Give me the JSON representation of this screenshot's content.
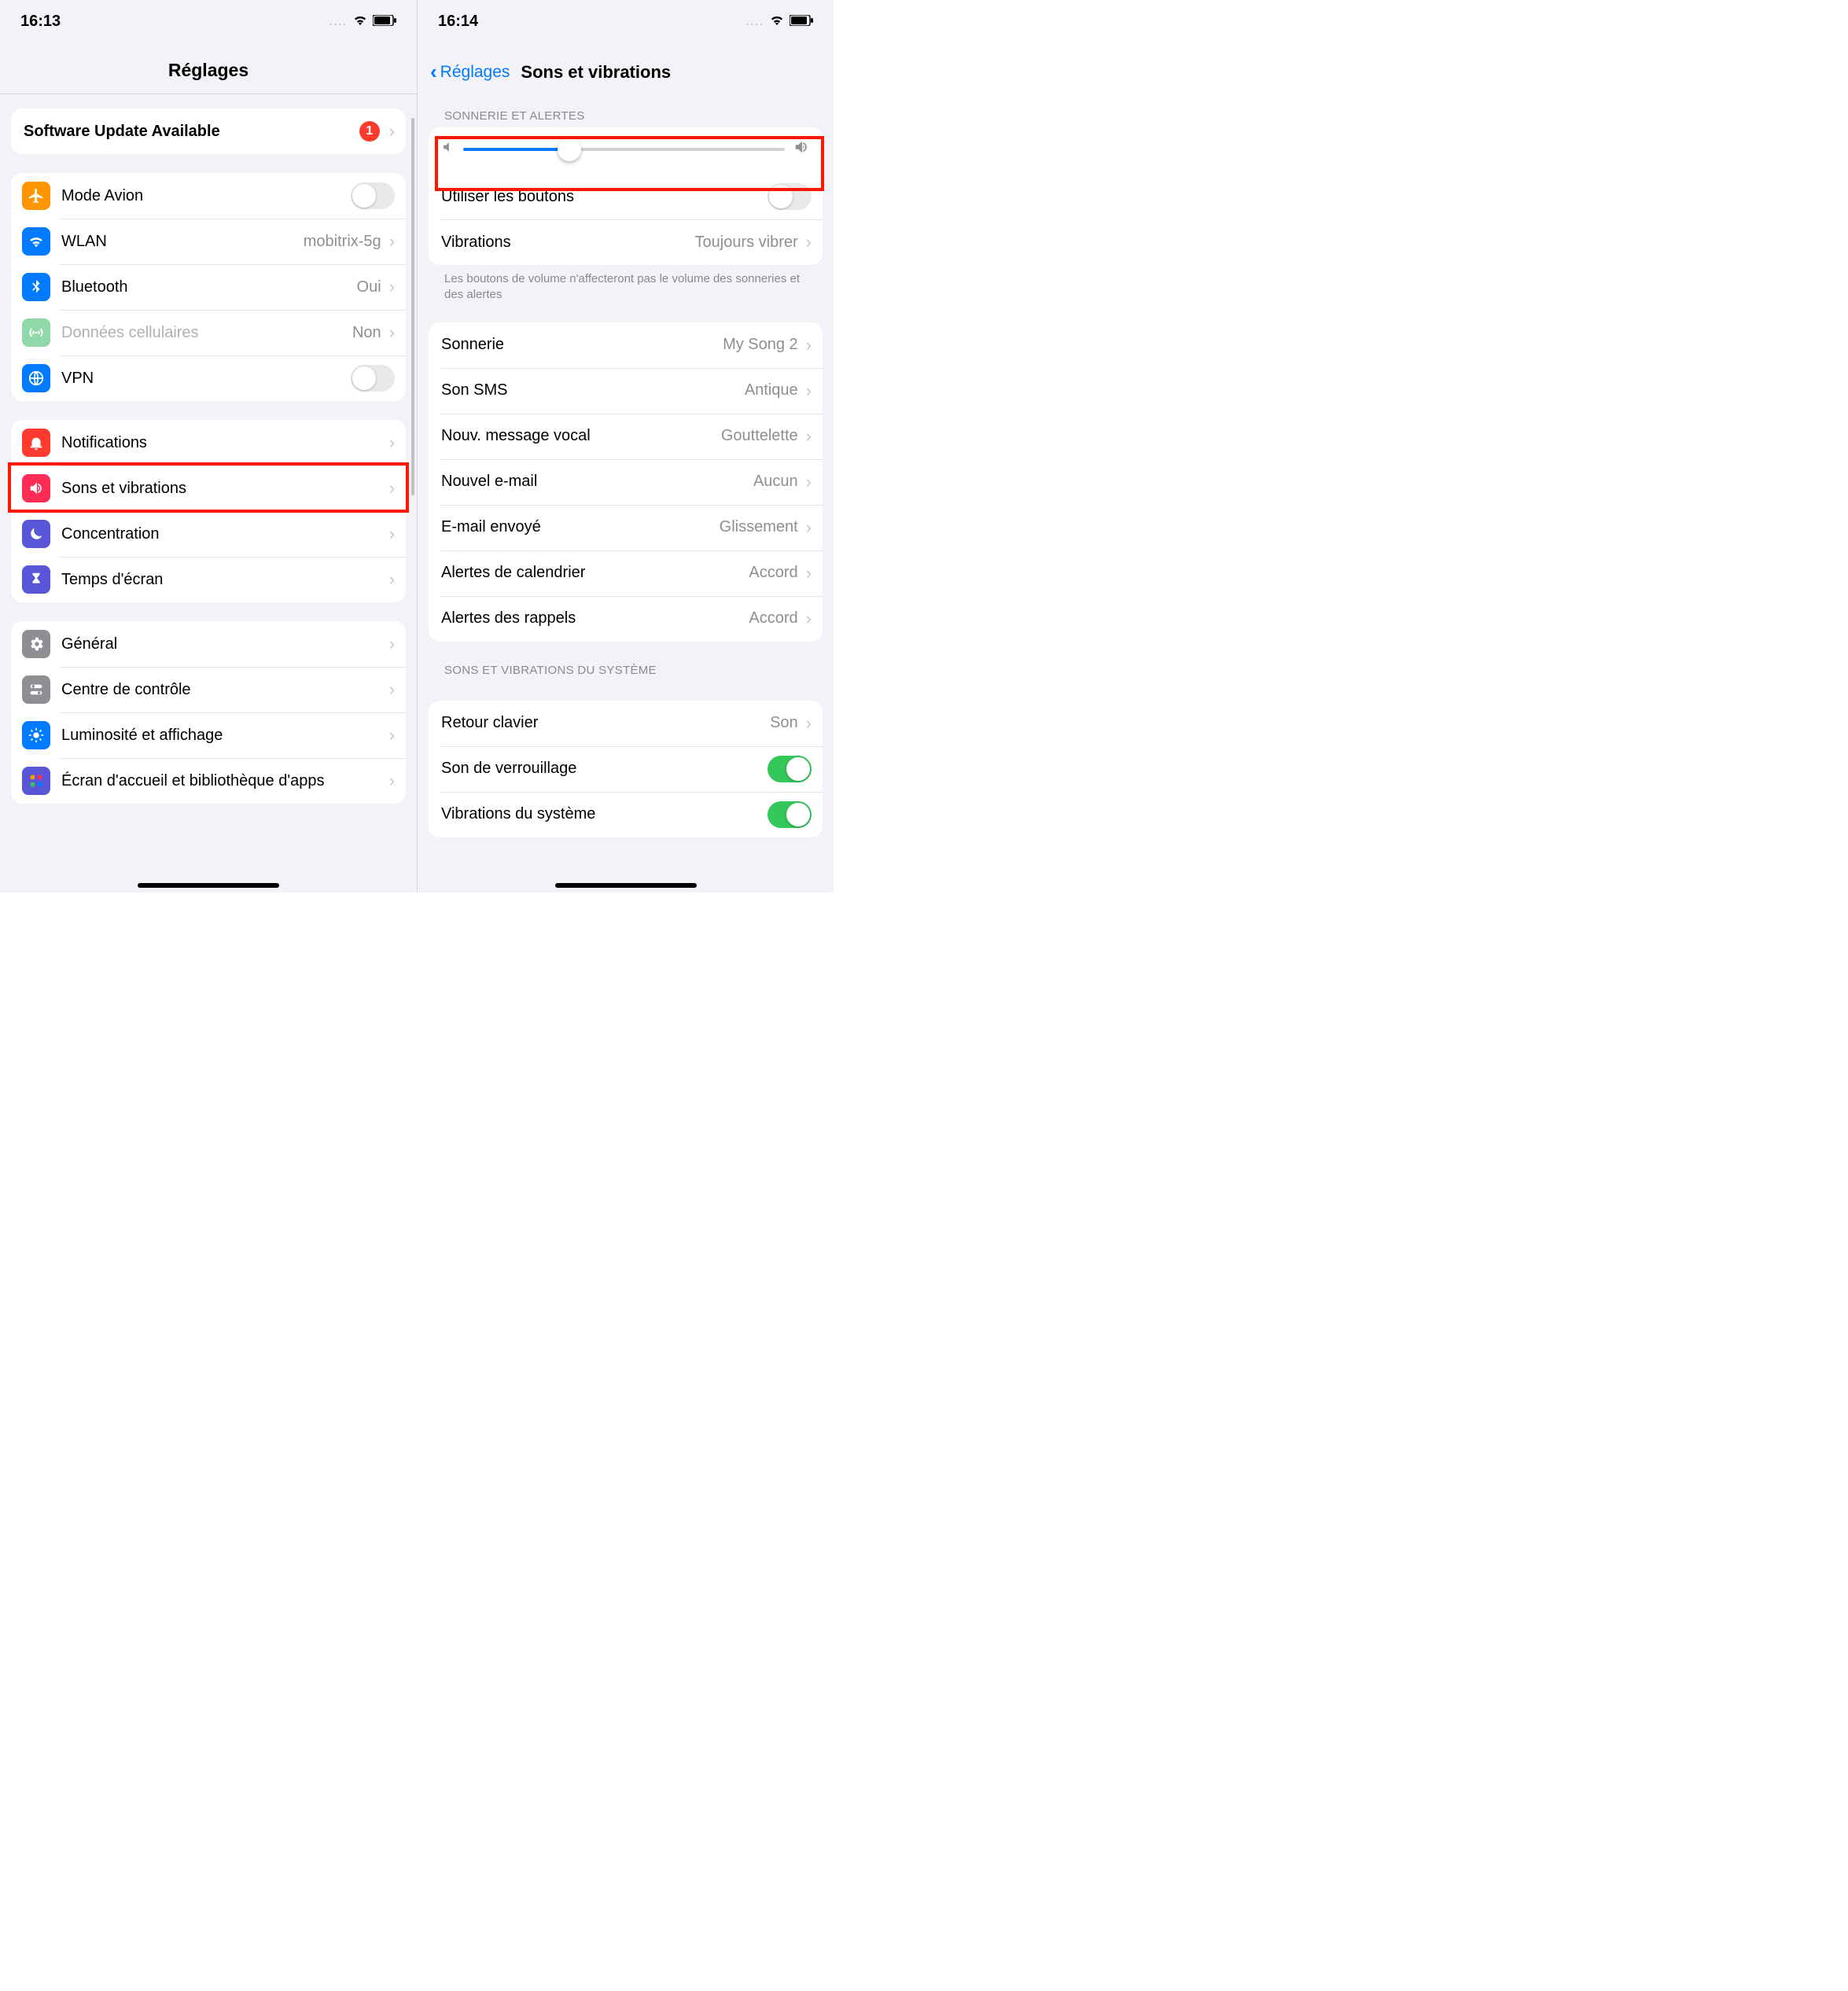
{
  "statusbar": {
    "time_left": "16:13",
    "time_right": "16:14"
  },
  "left": {
    "title": "Réglages",
    "software_update": {
      "label": "Software Update Available",
      "badge": "1"
    },
    "group1": {
      "airplane": {
        "label": "Mode Avion",
        "on": false,
        "icon_bg": "#ff9500"
      },
      "wifi": {
        "label": "WLAN",
        "value": "mobitrix-5g",
        "icon_bg": "#007aff"
      },
      "bluetooth": {
        "label": "Bluetooth",
        "value": "Oui",
        "icon_bg": "#007aff"
      },
      "cellular": {
        "label": "Données cellulaires",
        "value": "Non",
        "icon_bg": "#8fd9a8",
        "muted": true
      },
      "vpn": {
        "label": "VPN",
        "on": false,
        "icon_bg": "#007aff"
      }
    },
    "group2": {
      "notifications": {
        "label": "Notifications",
        "icon_bg": "#ff3b30"
      },
      "sounds": {
        "label": "Sons et vibrations",
        "icon_bg": "#ff2d55"
      },
      "focus": {
        "label": "Concentration",
        "icon_bg": "#5856d6"
      },
      "screentime": {
        "label": "Temps d'écran",
        "icon_bg": "#5856d6"
      }
    },
    "group3": {
      "general": {
        "label": "Général",
        "icon_bg": "#8e8e93"
      },
      "controlcenter": {
        "label": "Centre de contrôle",
        "icon_bg": "#8e8e93"
      },
      "display": {
        "label": "Luminosité et affichage",
        "icon_bg": "#007aff"
      },
      "homescreen": {
        "label": "Écran d'accueil et bibliothèque d'apps",
        "icon_bg": "#5856d6"
      }
    }
  },
  "right": {
    "back_label": "Réglages",
    "title": "Sons et vibrations",
    "section_header": "SONNERIE ET ALERTES",
    "slider_value_pct": 33,
    "use_buttons": {
      "label": "Utiliser les boutons",
      "on": false
    },
    "vibrations": {
      "label": "Vibrations",
      "value": "Toujours vibrer"
    },
    "section_footer": "Les boutons de volume n'affecteront pas le volume des sonneries et des alertes",
    "sounds": {
      "sonnerie": {
        "label": "Sonnerie",
        "value": "My Song 2"
      },
      "sms": {
        "label": "Son SMS",
        "value": "Antique"
      },
      "voicemail": {
        "label": "Nouv. message vocal",
        "value": "Gouttelette"
      },
      "newmail": {
        "label": "Nouvel e-mail",
        "value": "Aucun"
      },
      "sentmail": {
        "label": "E-mail envoyé",
        "value": "Glissement"
      },
      "calendar": {
        "label": "Alertes de calendrier",
        "value": "Accord"
      },
      "reminders": {
        "label": "Alertes des rappels",
        "value": "Accord"
      }
    },
    "system_header": "SONS ET VIBRATIONS DU SYSTÈME",
    "system": {
      "keyboard": {
        "label": "Retour clavier",
        "value": "Son"
      },
      "lock": {
        "label": "Son de verrouillage",
        "on": true
      },
      "sysvibe": {
        "label": "Vibrations du système",
        "on": true
      }
    }
  }
}
